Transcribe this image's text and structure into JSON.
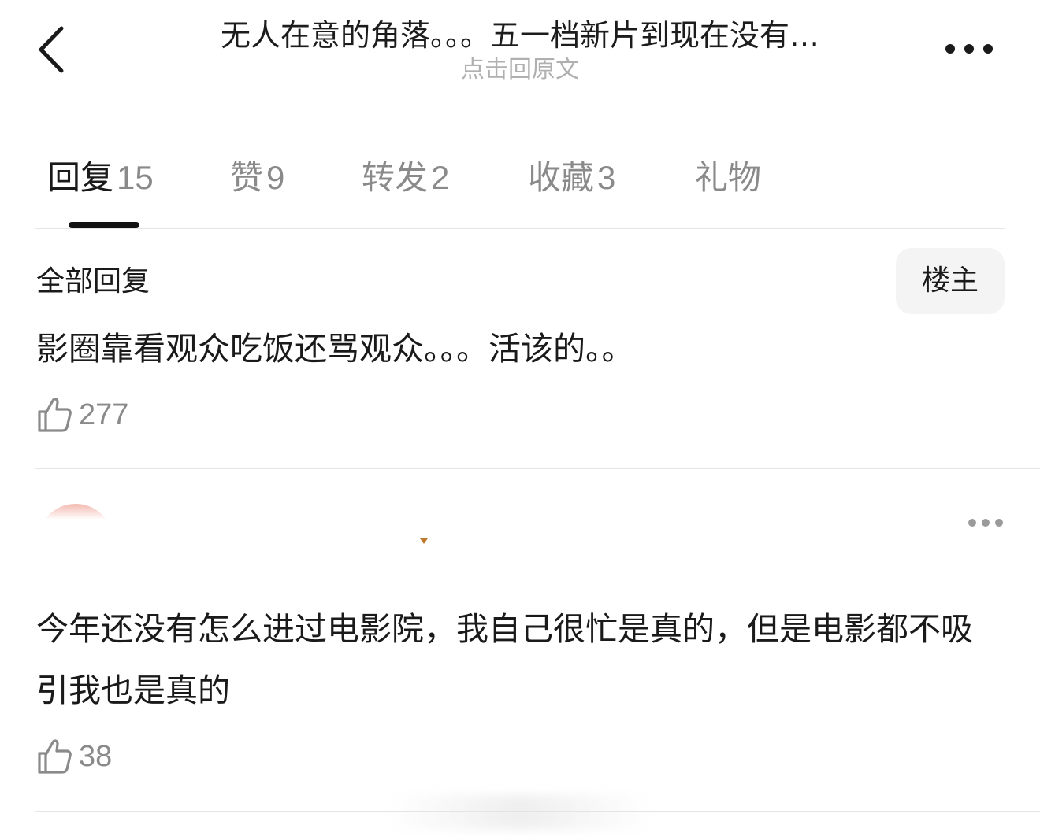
{
  "header": {
    "title": "无人在意的角落。。。五一档新片到现在没有…",
    "subtitle": "点击回原文",
    "back_icon": "chevron-left-icon",
    "more_icon": "more-horizontal-icon"
  },
  "tabs": [
    {
      "label": "回复",
      "count": "15",
      "active": true
    },
    {
      "label": "赞",
      "count": "9"
    },
    {
      "label": "转发",
      "count": "2"
    },
    {
      "label": "收藏",
      "count": "3"
    },
    {
      "label": "礼物",
      "count": ""
    }
  ],
  "section": {
    "title": "全部回复",
    "op_filter_label": "楼主"
  },
  "replies": [
    {
      "text": "影圈靠看观众吃饭还骂观众。。。活该的。。",
      "likes": "277"
    },
    {
      "text": "今年还没有怎么进过电影院，我自己很忙是真的，但是电影都不吸引我也是真的",
      "likes": "38"
    }
  ],
  "colors": {
    "text_primary": "#1a1a1a",
    "text_secondary": "#8a8a8a",
    "subtitle": "#b0b0b0",
    "divider": "#e5e5e5",
    "tab_indicator": "#111111",
    "chip_bg": "#f4f4f4"
  }
}
